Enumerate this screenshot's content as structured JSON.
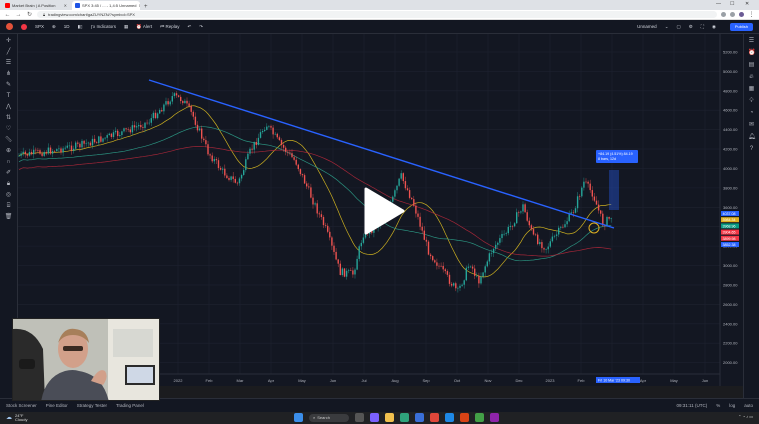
{
  "browser": {
    "tabs": [
      {
        "label": "Market Brain | A Position",
        "active": false,
        "favicon": "yt"
      },
      {
        "label": "SPX 3:45 / ... - 1,4:5 Unnamed",
        "active": true,
        "favicon": "tv"
      }
    ],
    "url": "tradingview.com/chart/gaZUYNZN/?symbol=SPX"
  },
  "header": {
    "symbol": "SPX",
    "timeframe": "1D",
    "indicators_label": "Indicators",
    "alert_label": "Alert",
    "replay_label": "Replay",
    "layout_name": "Unnamed",
    "publish_label": "Publish"
  },
  "chart_data": {
    "type": "candlestick",
    "price_axis_ticks": [
      "5200.00",
      "5000.00",
      "4800.00",
      "4600.00",
      "4400.00",
      "4200.00",
      "4000.00",
      "3800.00",
      "3600.00",
      "3400.00",
      "3200.00",
      "3000.00",
      "2800.00",
      "2600.00",
      "2400.00",
      "2200.00",
      "2000.00"
    ],
    "time_axis_ticks": [
      "2022",
      "Feb",
      "Mar",
      "Apr",
      "May",
      "Jun",
      "Jul",
      "Aug",
      "Sep",
      "Oct",
      "Nov",
      "Dec",
      "2023",
      "Feb",
      "Mar",
      "Apr",
      "May",
      "Jun",
      "Jul"
    ],
    "position_tool_label": "+84.19 (4.51%) 84.19",
    "position_tool_sublabel": "8 bars, 12d",
    "price_tags": [
      {
        "label": "4037.08",
        "color": "#2962ff"
      },
      {
        "label": "3984.34",
        "color": "#e0b020"
      },
      {
        "label": "3968.96",
        "color": "#089981"
      },
      {
        "label": "3904.65",
        "color": "#f23645"
      },
      {
        "label": "3899.98",
        "color": "#f23645"
      },
      {
        "label": "3852.38",
        "color": "#2962ff"
      }
    ],
    "time_tag": "Fri 10 Mar '23 09:30"
  },
  "bottom_tabs": [
    "Stock Screener",
    "Pine Editor",
    "Strategy Tester",
    "Trading Panel"
  ],
  "status": {
    "time": "09:31:11 (UTC)",
    "percent": "%",
    "log": "log",
    "auto": "auto"
  },
  "taskbar": {
    "temp": "24°F",
    "condition": "Cloudy",
    "search": "Search"
  },
  "colors": {
    "bg": "#131722",
    "up": "#26a69a",
    "down": "#ef5350",
    "trendline": "#2962ff",
    "ma_short": "#e0c020",
    "ma_mid": "#2e9e8a",
    "ma_long": "#b0283a"
  }
}
